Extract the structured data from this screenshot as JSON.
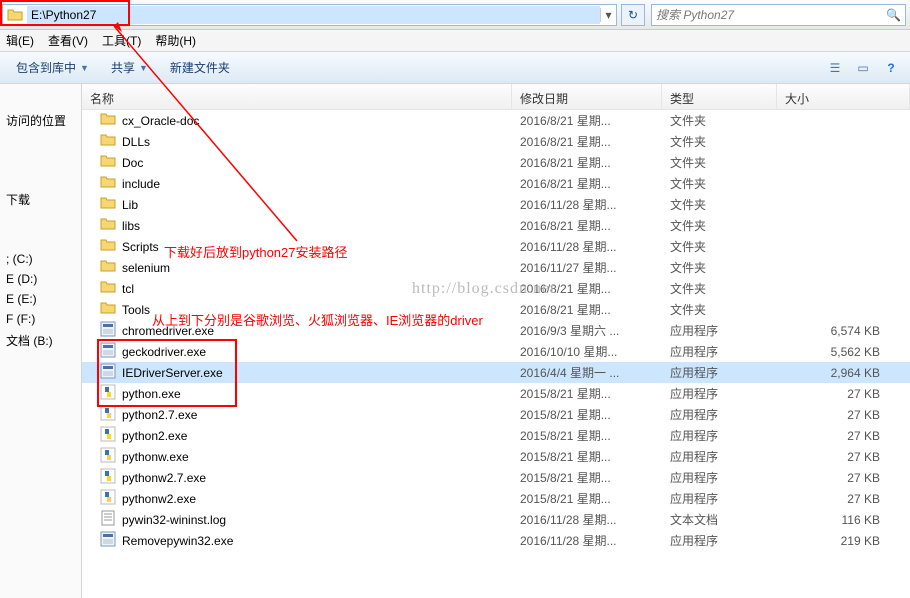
{
  "address": {
    "path": "E:\\Python27"
  },
  "search": {
    "placeholder": "搜索 Python27"
  },
  "menubar": {
    "edit": "辑(E)",
    "edit_u": "E",
    "view": "查看(V)",
    "view_u": "V",
    "tools": "工具(T)",
    "tools_u": "T",
    "help": "帮助(H)",
    "help_u": "H"
  },
  "toolbar": {
    "include": "包含到库中",
    "share": "共享",
    "newfolder": "新建文件夹"
  },
  "columns": {
    "name": "名称",
    "date": "修改日期",
    "type": "类型",
    "size": "大小"
  },
  "sidebar": {
    "items": [
      "",
      "访问的位置",
      "",
      "",
      "",
      "下载",
      "",
      "",
      "; (C:)",
      "E (D:)",
      "E (E:)",
      "F (F:)",
      "文档 (B:)",
      ""
    ]
  },
  "files": [
    {
      "icon": "folder",
      "name": "cx_Oracle-doc",
      "date": "2016/8/21 星期...",
      "type": "文件夹",
      "size": ""
    },
    {
      "icon": "folder",
      "name": "DLLs",
      "date": "2016/8/21 星期...",
      "type": "文件夹",
      "size": ""
    },
    {
      "icon": "folder",
      "name": "Doc",
      "date": "2016/8/21 星期...",
      "type": "文件夹",
      "size": ""
    },
    {
      "icon": "folder",
      "name": "include",
      "date": "2016/8/21 星期...",
      "type": "文件夹",
      "size": ""
    },
    {
      "icon": "folder",
      "name": "Lib",
      "date": "2016/11/28 星期...",
      "type": "文件夹",
      "size": ""
    },
    {
      "icon": "folder",
      "name": "libs",
      "date": "2016/8/21 星期...",
      "type": "文件夹",
      "size": ""
    },
    {
      "icon": "folder",
      "name": "Scripts",
      "date": "2016/11/28 星期...",
      "type": "文件夹",
      "size": ""
    },
    {
      "icon": "folder",
      "name": "selenium",
      "date": "2016/11/27 星期...",
      "type": "文件夹",
      "size": ""
    },
    {
      "icon": "folder",
      "name": "tcl",
      "date": "2016/8/21 星期...",
      "type": "文件夹",
      "size": ""
    },
    {
      "icon": "folder",
      "name": "Tools",
      "date": "2016/8/21 星期...",
      "type": "文件夹",
      "size": ""
    },
    {
      "icon": "exe",
      "name": "chromedriver.exe",
      "date": "2016/9/3 星期六 ...",
      "type": "应用程序",
      "size": "6,574 KB"
    },
    {
      "icon": "exe",
      "name": "geckodriver.exe",
      "date": "2016/10/10 星期...",
      "type": "应用程序",
      "size": "5,562 KB"
    },
    {
      "icon": "exe",
      "name": "IEDriverServer.exe",
      "date": "2016/4/4 星期一 ...",
      "type": "应用程序",
      "size": "2,964 KB",
      "selected": true
    },
    {
      "icon": "py",
      "name": "python.exe",
      "date": "2015/8/21 星期...",
      "type": "应用程序",
      "size": "27 KB"
    },
    {
      "icon": "py",
      "name": "python2.7.exe",
      "date": "2015/8/21 星期...",
      "type": "应用程序",
      "size": "27 KB"
    },
    {
      "icon": "py",
      "name": "python2.exe",
      "date": "2015/8/21 星期...",
      "type": "应用程序",
      "size": "27 KB"
    },
    {
      "icon": "py",
      "name": "pythonw.exe",
      "date": "2015/8/21 星期...",
      "type": "应用程序",
      "size": "27 KB"
    },
    {
      "icon": "py",
      "name": "pythonw2.7.exe",
      "date": "2015/8/21 星期...",
      "type": "应用程序",
      "size": "27 KB"
    },
    {
      "icon": "py",
      "name": "pythonw2.exe",
      "date": "2015/8/21 星期...",
      "type": "应用程序",
      "size": "27 KB"
    },
    {
      "icon": "txt",
      "name": "pywin32-wininst.log",
      "date": "2016/11/28 星期...",
      "type": "文本文档",
      "size": "116 KB"
    },
    {
      "icon": "exe",
      "name": "Removepywin32.exe",
      "date": "2016/11/28 星期...",
      "type": "应用程序",
      "size": "219 KB"
    }
  ],
  "annotations": {
    "note1": "下载好后放到python27安装路径",
    "note2": "从上到下分别是谷歌浏览、火狐浏览器、IE浏览器的driver",
    "watermark": "http://blog.csdn.net"
  }
}
